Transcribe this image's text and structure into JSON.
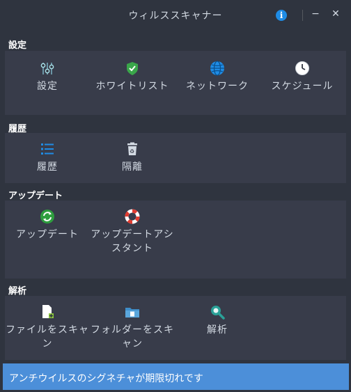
{
  "window": {
    "title": "ウィルススキャナー",
    "info_glyph": "i",
    "minimize_glyph": "−",
    "close_glyph": "✕"
  },
  "sections": {
    "settings": {
      "title": "設定",
      "items": [
        {
          "label": "設定",
          "icon": "settings-sliders-icon"
        },
        {
          "label": "ホワイトリスト",
          "icon": "shield-check-icon"
        },
        {
          "label": "ネットワーク",
          "icon": "globe-icon"
        },
        {
          "label": "スケジュール",
          "icon": "clock-icon"
        }
      ]
    },
    "history": {
      "title": "履歴",
      "items": [
        {
          "label": "履歴",
          "icon": "list-icon"
        },
        {
          "label": "隔離",
          "icon": "trash-icon"
        }
      ]
    },
    "update": {
      "title": "アップデート",
      "items": [
        {
          "label": "アップデート",
          "icon": "refresh-icon"
        },
        {
          "label": "アップデートアシスタント",
          "icon": "lifebuoy-icon"
        }
      ]
    },
    "analysis": {
      "title": "解析",
      "items": [
        {
          "label": "ファイルをスキャン",
          "icon": "file-add-icon"
        },
        {
          "label": "フォルダーをスキャン",
          "icon": "folder-icon"
        },
        {
          "label": "解析",
          "icon": "magnifier-icon"
        }
      ]
    }
  },
  "status": {
    "message": "アンチウイルスのシグネチャが期限切れです"
  },
  "colors": {
    "background": "#2f343f",
    "panel": "#383c4a",
    "status_bar": "#4c8fd9",
    "accent_blue": "#1f8ce5",
    "green": "#2e9e3e",
    "red": "#e03c31"
  }
}
